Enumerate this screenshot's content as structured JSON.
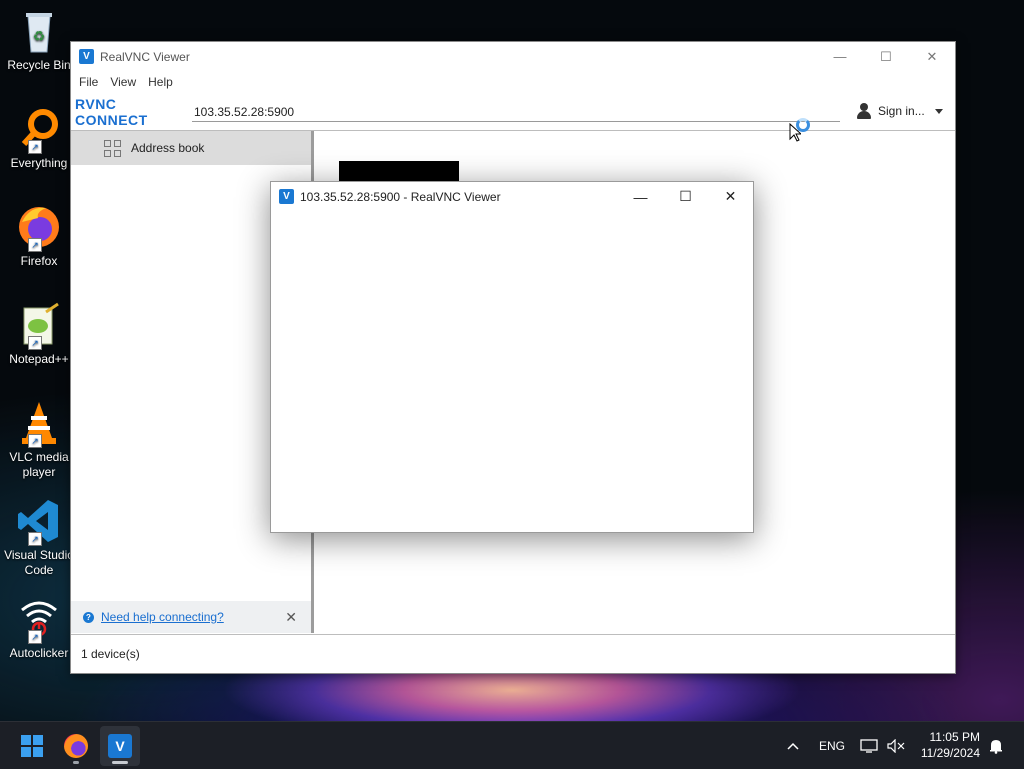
{
  "desktop": {
    "icons": [
      {
        "label": "Recycle Bin"
      },
      {
        "label": "Everything"
      },
      {
        "label": "Firefox"
      },
      {
        "label": "Notepad++"
      },
      {
        "label": "VLC media player"
      },
      {
        "label": "Visual Studio Code"
      },
      {
        "label": "Autoclicker"
      }
    ]
  },
  "main_window": {
    "title": "RealVNC Viewer",
    "menu": [
      "File",
      "View",
      "Help"
    ],
    "logo_text": "RVNC CONNECT",
    "address_value": "103.35.52.28:5900",
    "signin_label": "Sign in...",
    "sidebar": {
      "address_book_label": "Address book",
      "help_link": "Need help connecting?"
    },
    "status": "1 device(s)"
  },
  "vnc_window": {
    "title": "103.35.52.28:5900 - RealVNC Viewer"
  },
  "taskbar": {
    "language": "ENG",
    "time": "11:05 PM",
    "date": "11/29/2024"
  },
  "colors": {
    "accent": "#1a78d2",
    "link": "#1a6fd0"
  }
}
